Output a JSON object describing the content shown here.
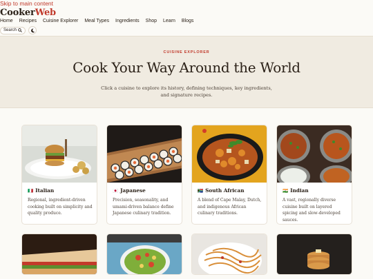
{
  "skip_link": "Skip to main content",
  "brand": {
    "part1": "Cooker",
    "part2": "Web"
  },
  "nav": [
    "Home",
    "Recipes",
    "Cuisine Explorer",
    "Meal Types",
    "Ingredients",
    "Shop",
    "Learn",
    "Blogs"
  ],
  "search_label": "Search",
  "hero": {
    "eyebrow": "CUISINE EXPLORER",
    "title": "Cook Your Way Around the World",
    "subtitle": "Click a cuisine to explore its history, defining techniques, key ingredients, and signature recipes."
  },
  "cuisines": [
    {
      "flag": "🇮🇹",
      "name": "Italian",
      "desc": "Regional, ingredient-driven cooking built on simplicity and quality produce."
    },
    {
      "flag": "🇯🇵",
      "name": "Japanese",
      "desc": "Precision, seasonality, and umami-driven balance define Japanese culinary tradition."
    },
    {
      "flag": "🇿🇦",
      "name": "South African",
      "desc": "A blend of Cape Malay, Dutch, and indigenous African culinary traditions."
    },
    {
      "flag": "🇮🇳",
      "name": "Indian",
      "desc": "A vast, regionally diverse cuisine built on layered spicing and slow-developed sauces."
    }
  ],
  "colors": {
    "accent": "#c0392b",
    "hero_bg": "#f0ebe1",
    "page_bg": "#fbfaf6"
  }
}
